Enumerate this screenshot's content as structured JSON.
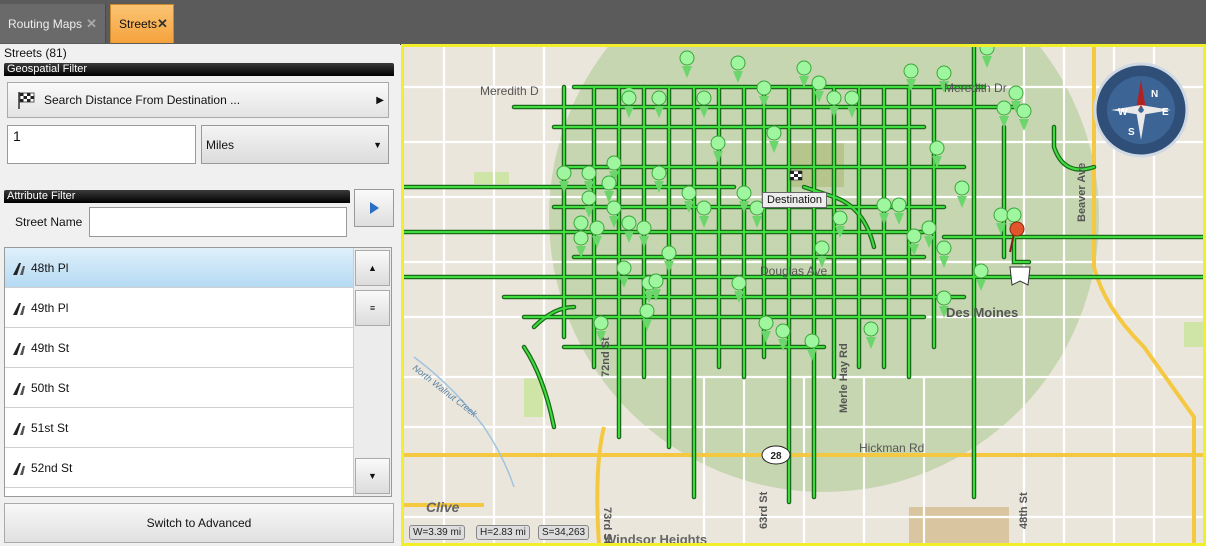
{
  "tabs": [
    {
      "label": "Routing Maps",
      "close": "✕"
    },
    {
      "label": "Streets",
      "close": "✕"
    }
  ],
  "panel": {
    "count_label": "Streets (81)",
    "geo_header": "Geospatial Filter",
    "search_label": "Search Distance From Destination ...",
    "search_arrow": "▶",
    "distance_value": "1",
    "units_value": "Miles",
    "units_caret": "▼",
    "attr_header": "Attribute Filter",
    "street_name_label": "Street Name",
    "street_name_value": "",
    "advanced_label": "Switch to Advanced",
    "scroll_up": "▲",
    "scroll_thumb": "≡",
    "scroll_down": "▼"
  },
  "streets": [
    "48th Pl",
    "49th Pl",
    "49th St",
    "50th St",
    "51st St",
    "52nd St"
  ],
  "map": {
    "labels": {
      "meredith_w": "Meredith D",
      "meredith_e": "Meredith Dr",
      "douglas": "Douglas Ave",
      "des_moines": "Des Moines",
      "hickman": "Hickman Rd",
      "clive": "Clive",
      "windsor": "Windsor Heights",
      "n_walnut": "North Walnut Creek",
      "st72": "72nd St",
      "st73": "73rd St",
      "st63": "63rd St",
      "st48": "48th St",
      "merle_hay": "Merle Hay Rd",
      "beaver": "Beaver Ave",
      "route28": "28",
      "destination": "Destination"
    },
    "scale": {
      "w": "W=3.39 mi",
      "h": "H=2.83 mi",
      "s": "S=34,263"
    },
    "compass": [
      "N",
      "E",
      "S",
      "W"
    ],
    "colors": {
      "highlight": "#2ecc2e",
      "road": "#ffffff",
      "arterial": "#f5c842",
      "radius": "#a7c98c"
    }
  }
}
